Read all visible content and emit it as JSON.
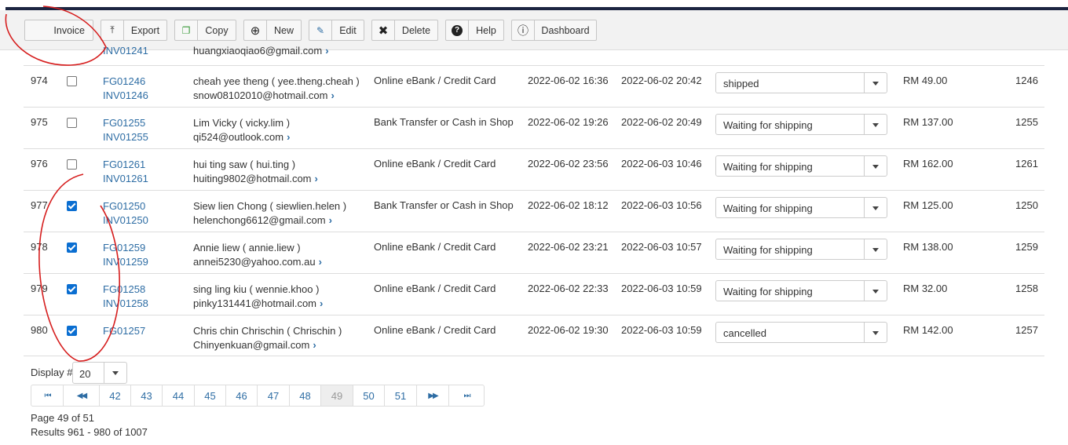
{
  "toolbar": {
    "buttons": [
      {
        "label": "Invoice",
        "icon": "invoice-icon",
        "glyph": ""
      },
      {
        "label": "Export",
        "icon": "upload-icon",
        "glyph": "⤒"
      },
      {
        "label": "Copy",
        "icon": "copy-icon",
        "glyph": "❐"
      },
      {
        "label": "New",
        "icon": "plus-circle-icon",
        "glyph": "⊕"
      },
      {
        "label": "Edit",
        "icon": "edit-icon",
        "glyph": "✎"
      },
      {
        "label": "Delete",
        "icon": "close-icon",
        "glyph": "✖"
      },
      {
        "label": "Help",
        "icon": "help-icon",
        "glyph": "?"
      },
      {
        "label": "Dashboard",
        "icon": "dashboard-icon",
        "glyph": "ⓘ"
      }
    ]
  },
  "partial_row": {
    "order": "INV01241",
    "email": "huangxiaoqiao6@gmail.com"
  },
  "rows": [
    {
      "num": "974",
      "checked": false,
      "order": "FG01246",
      "invoice": "INV01246",
      "name": "cheah yee theng ( yee.theng.cheah )",
      "email": "snow08102010@hotmail.com",
      "payment": "Online eBank / Credit Card",
      "date1": "2022-06-02 16:36",
      "date2": "2022-06-02 20:42",
      "status": "shipped",
      "amount": "RM 49.00",
      "id": "1246"
    },
    {
      "num": "975",
      "checked": false,
      "order": "FG01255",
      "invoice": "INV01255",
      "name": "Lim Vicky ( vicky.lim )",
      "email": "qi524@outlook.com",
      "payment": "Bank Transfer or Cash in Shop",
      "date1": "2022-06-02 19:26",
      "date2": "2022-06-02 20:49",
      "status": "Waiting for shipping",
      "amount": "RM 137.00",
      "id": "1255"
    },
    {
      "num": "976",
      "checked": false,
      "order": "FG01261",
      "invoice": "INV01261",
      "name": "hui ting saw ( hui.ting )",
      "email": "huiting9802@hotmail.com",
      "payment": "Online eBank / Credit Card",
      "date1": "2022-06-02 23:56",
      "date2": "2022-06-03 10:46",
      "status": "Waiting for shipping",
      "amount": "RM 162.00",
      "id": "1261"
    },
    {
      "num": "977",
      "checked": true,
      "order": "FG01250",
      "invoice": "INV01250",
      "name": "Siew lien Chong ( siewlien.helen )",
      "email": "helenchong6612@gmail.com",
      "payment": "Bank Transfer or Cash in Shop",
      "date1": "2022-06-02 18:12",
      "date2": "2022-06-03 10:56",
      "status": "Waiting for shipping",
      "amount": "RM 125.00",
      "id": "1250"
    },
    {
      "num": "978",
      "checked": true,
      "order": "FG01259",
      "invoice": "INV01259",
      "name": "Annie liew ( annie.liew )",
      "email": "annei5230@yahoo.com.au",
      "payment": "Online eBank / Credit Card",
      "date1": "2022-06-02 23:21",
      "date2": "2022-06-03 10:57",
      "status": "Waiting for shipping",
      "amount": "RM 138.00",
      "id": "1259"
    },
    {
      "num": "979",
      "checked": true,
      "order": "FG01258",
      "invoice": "INV01258",
      "name": "sing ling kiu ( wennie.khoo )",
      "email": "pinky131441@hotmail.com",
      "payment": "Online eBank / Credit Card",
      "date1": "2022-06-02 22:33",
      "date2": "2022-06-03 10:59",
      "status": "Waiting for shipping",
      "amount": "RM 32.00",
      "id": "1258"
    },
    {
      "num": "980",
      "checked": true,
      "order": "FG01257",
      "invoice": "",
      "name": "Chris chin Chrischin ( Chrischin )",
      "email": "Chinyenkuan@gmail.com",
      "payment": "Online eBank / Credit Card",
      "date1": "2022-06-02 19:30",
      "date2": "2022-06-03 10:59",
      "status": "cancelled",
      "amount": "RM 142.00",
      "id": "1257"
    }
  ],
  "display": {
    "label": "Display #",
    "value": "20"
  },
  "pagination": {
    "items": [
      {
        "label": "⏮",
        "icon": "first-page-icon"
      },
      {
        "label": "◀◀",
        "icon": "previous-page-icon"
      },
      {
        "label": "42"
      },
      {
        "label": "43"
      },
      {
        "label": "44"
      },
      {
        "label": "45"
      },
      {
        "label": "46"
      },
      {
        "label": "47"
      },
      {
        "label": "48"
      },
      {
        "label": "49",
        "current": true
      },
      {
        "label": "50"
      },
      {
        "label": "51"
      },
      {
        "label": "▶▶",
        "icon": "next-page-icon"
      },
      {
        "label": "⏭",
        "icon": "last-page-icon"
      }
    ],
    "page_text": "Page 49 of 51",
    "results_text": "Results 961 - 980 of 1007"
  },
  "colors": {
    "link": "#2e6da4",
    "checkbox": "#0a6ed1",
    "annotation": "#d61e1e",
    "topbar": "#1c2541"
  }
}
